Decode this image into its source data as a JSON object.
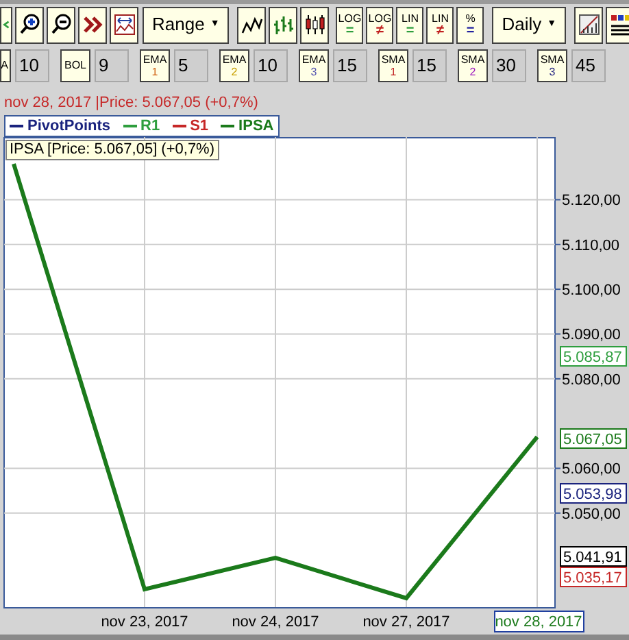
{
  "toolbar": [
    [
      {
        "kind": "back",
        "partial": true
      },
      {
        "kind": "zoomin",
        "partial": false
      },
      {
        "kind": "zoomout",
        "partial": false
      },
      {
        "kind": "forward",
        "partial": false
      },
      {
        "kind": "fit",
        "partial": false
      },
      {
        "kind": "dropdown",
        "label": "Range",
        "arrow": "▼"
      }
    ],
    [
      {
        "kind": "line",
        "partial": false
      },
      {
        "kind": "bars",
        "partial": false
      },
      {
        "kind": "candles",
        "partial": false
      }
    ],
    [
      {
        "kind": "scale",
        "label": "LOG",
        "sign": "=",
        "color": "#2e9e3e"
      },
      {
        "kind": "scale",
        "label": "LOG",
        "sign": "≠",
        "color": "#c02020"
      },
      {
        "kind": "scale",
        "label": "LIN",
        "sign": "=",
        "color": "#2e9e3e"
      },
      {
        "kind": "scale",
        "label": "LIN",
        "sign": "≠",
        "color": "#c02020"
      },
      {
        "kind": "scale",
        "label": "%",
        "sign": "=",
        "color": "#2020a0"
      }
    ],
    [
      {
        "kind": "dropdown",
        "label": "Daily",
        "arrow": "▼"
      }
    ],
    [
      {
        "kind": "settings",
        "partial": false
      },
      {
        "kind": "palette",
        "partial": false
      }
    ]
  ],
  "indicators": [
    {
      "label": "A",
      "value": "10",
      "partial": true
    },
    {
      "label": "BOL",
      "value": "9",
      "partial": false
    },
    {
      "label": "EMA",
      "sub": "1",
      "color": "#d06010",
      "value": "5",
      "partial": false
    },
    {
      "label": "EMA",
      "sub": "2",
      "color": "#c8a000",
      "value": "10",
      "partial": false
    },
    {
      "label": "EMA",
      "sub": "3",
      "color": "#5050b0",
      "value": "15",
      "partial": false
    },
    {
      "label": "SMA",
      "sub": "1",
      "color": "#c02020",
      "value": "15",
      "partial": false
    },
    {
      "label": "SMA",
      "sub": "2",
      "color": "#a020c0",
      "value": "30",
      "partial": false
    },
    {
      "label": "SMA",
      "sub": "3",
      "color": "#202080",
      "value": "45",
      "partial": false
    }
  ],
  "header": "nov 28, 2017 |Price: 5.067,05 (+0,7%)",
  "legend": [
    {
      "label": "PivotPoints",
      "color": "#1a237e"
    },
    {
      "label": "R1",
      "color": "#2e9e3e"
    },
    {
      "label": "S1",
      "color": "#c62828"
    }
  ],
  "tooltip": "IPSA [Price: 5.067,05] (+0,7%)",
  "chart_data": {
    "type": "line",
    "categories": [
      null,
      "nov 23, 2017",
      "nov 24, 2017",
      "nov 27, 2017",
      "nov 28, 2017"
    ],
    "ylim": [
      5029,
      5134
    ],
    "yticks": [
      {
        "value": 5120,
        "label": "5.120,00"
      },
      {
        "value": 5110,
        "label": "5.110,00"
      },
      {
        "value": 5100,
        "label": "5.100,00"
      },
      {
        "value": 5090,
        "label": "5.090,00"
      },
      {
        "value": 5080,
        "label": "5.080,00"
      },
      {
        "value": 5060,
        "label": "5.060,00"
      },
      {
        "value": 5050,
        "label": "5.050,00"
      }
    ],
    "series": [
      {
        "name": "IPSA",
        "color": "#1b7a1b",
        "values": [
          5128,
          5033,
          5040,
          5031,
          5067
        ]
      }
    ],
    "grid": true
  },
  "price_markers": [
    {
      "label": "5.085,87",
      "color": "#2e9e3e"
    },
    {
      "label": "5.067,05",
      "color": "#1b7a1b"
    },
    {
      "label": "5.053,98",
      "color": "#1a237e"
    },
    {
      "label": "5.041,91",
      "color": "#000000"
    },
    {
      "label": "5.035,17",
      "color": "#c62828"
    }
  ]
}
